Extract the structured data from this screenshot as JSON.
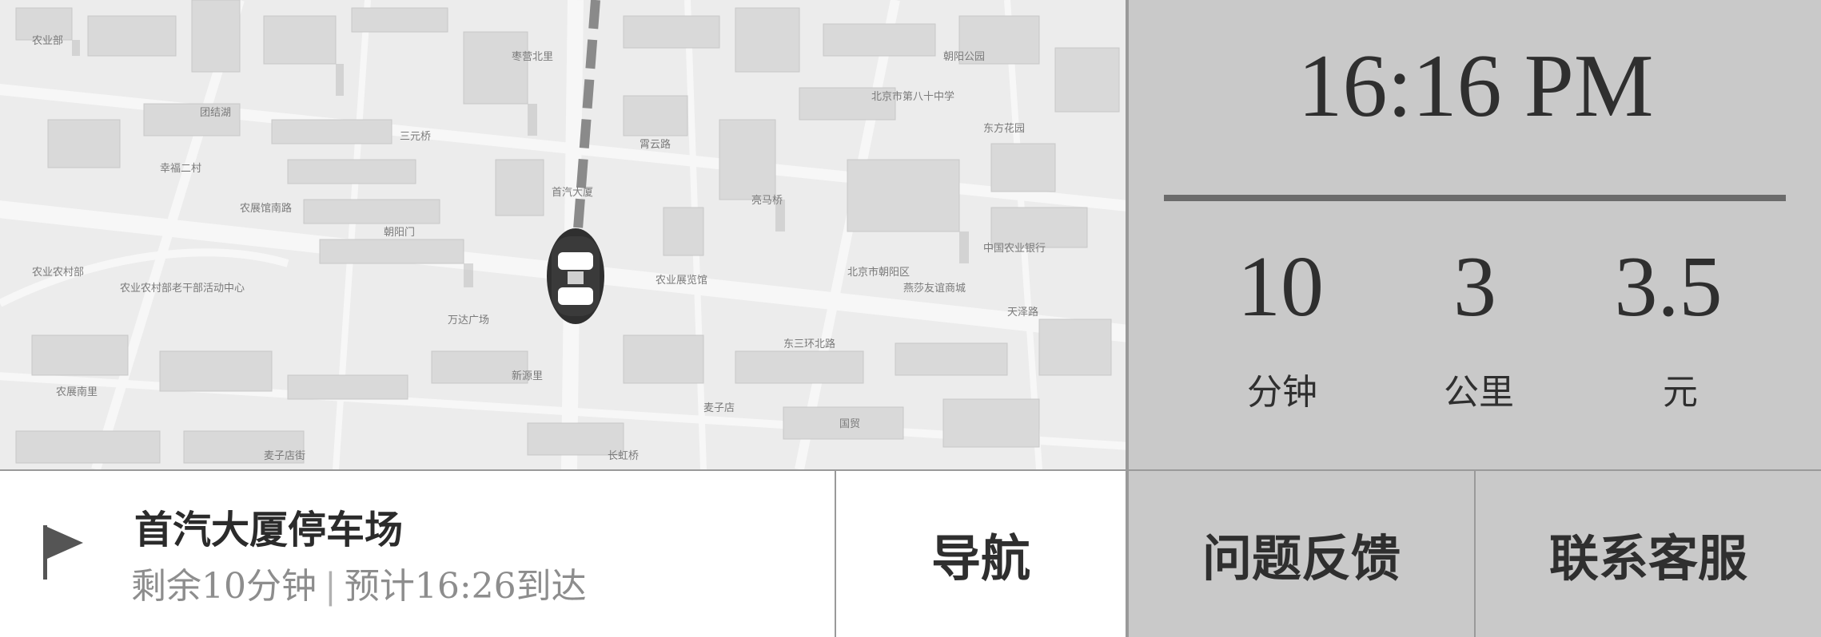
{
  "status": {
    "time": "16:16 PM"
  },
  "trip_stats": [
    {
      "value": "10",
      "unit": "分钟"
    },
    {
      "value": "3",
      "unit": "公里"
    },
    {
      "value": "3.5",
      "unit": "元"
    }
  ],
  "destination": {
    "name": "首汽大厦停车场",
    "remaining": "剩余10分钟",
    "separator": "|",
    "arrival": "预计16:26到达",
    "icon": "flag-icon"
  },
  "buttons": {
    "navigate": "导航",
    "feedback": "问题反馈",
    "contact_support": "联系客服"
  },
  "map": {
    "vehicle_icon": "car-icon",
    "labels": [
      "农业部",
      "北京市第八十中学",
      "东方花园",
      "中国农业银行",
      "农业农村部",
      "首汽大厦",
      "农业农村部老干部活动中心",
      "农展南里",
      "麦子店街",
      "万达广场",
      "农业展览馆",
      "朝阳公园",
      "亮马桥",
      "北京市朝阳区",
      "霄云路",
      "东三环北路",
      "团结湖",
      "三元桥",
      "燕莎友谊商城",
      "枣营北里",
      "农展馆南路",
      "天泽路",
      "新源里",
      "麦子店",
      "幸福二村",
      "朝阳门",
      "国贸",
      "长虹桥"
    ]
  },
  "colors": {
    "panel_gray": "#c9c9c9",
    "map_background": "#ececec",
    "text_dark": "#2f2f2f",
    "text_muted": "#8d8d8d",
    "route": "#8a8a8a"
  }
}
